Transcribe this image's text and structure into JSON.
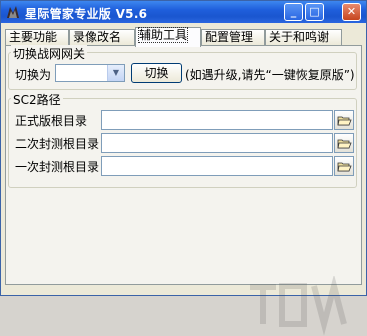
{
  "window": {
    "title": "星际管家专业版 V5.6",
    "minimize_label": "_",
    "maximize_label": "□",
    "close_label": "✕"
  },
  "tabs": [
    {
      "label": "主要功能",
      "active": false
    },
    {
      "label": "录像改名",
      "active": false
    },
    {
      "label": "辅助工具",
      "active": true
    },
    {
      "label": "配置管理",
      "active": false
    },
    {
      "label": "关于和鸣谢",
      "active": false
    }
  ],
  "gateway_group": {
    "title": "切换战网网关",
    "switch_label": "切换为",
    "combo_value": "",
    "switch_button": "切换",
    "hint": "(如遇升级,请先“一键恢复原版”)"
  },
  "sc2_group": {
    "title": "SC2路径",
    "rows": [
      {
        "label": "正式版根目录",
        "value": ""
      },
      {
        "label": "二次封测根目录",
        "value": ""
      },
      {
        "label": "一次封测根目录",
        "value": ""
      }
    ]
  },
  "icons": {
    "app": "starcraft-app-icon",
    "browse": "open-folder-icon",
    "watermark": "watermark-logo"
  }
}
